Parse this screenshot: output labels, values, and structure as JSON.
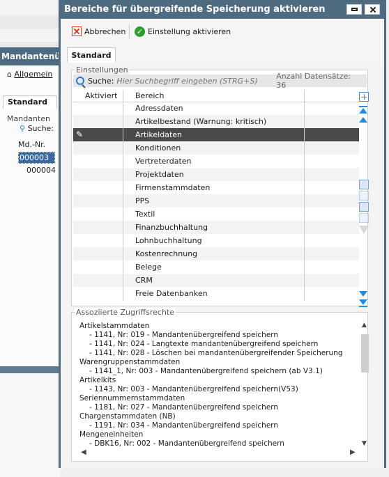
{
  "background_window": {
    "title": "Mandantenüb",
    "toolbar_item": "Allgemein",
    "tab": "Standard",
    "group_label": "Mandanten",
    "search_label": "Suche:",
    "column": "Md.-Nr.",
    "rows": [
      "000003",
      "000004"
    ]
  },
  "dialog": {
    "title": "Bereiche für übergreifende Speicherung aktivieren",
    "toolbar": {
      "cancel_label": "Abbrechen",
      "activate_label": "Einstellung aktivieren"
    },
    "tab": "Standard",
    "settings": {
      "group_label": "Einstellungen",
      "search_label": "Suche:",
      "search_placeholder": "Hier Suchbegriff eingeben (STRG+S)",
      "record_count": "Anzahl Datensätze: 36",
      "columns": [
        "Aktiviert",
        "Bereich"
      ],
      "selected_index": 2,
      "rows": [
        "Adressdaten",
        "Artikelbestand (Warnung: kritisch)",
        "Artikeldaten",
        "Konditionen",
        "Vertreterdaten",
        "Projektdaten",
        "Firmenstammdaten",
        "PPS",
        "Textil",
        "Finanzbuchhaltung",
        "Lohnbuchhaltung",
        "Kostenrechnung",
        "Belege",
        "CRM",
        "Freie Datenbanken"
      ]
    },
    "rights": {
      "group_label": "Assoziierte Zugriffsrechte",
      "lines": [
        {
          "text": "Artikelstammdaten",
          "indent": false
        },
        {
          "text": "- 1141, Nr: 019 - Mandantenübergreifend speichern",
          "indent": true
        },
        {
          "text": "- 1141, Nr: 024 - Langtexte mandantenübergreifend speichern",
          "indent": true
        },
        {
          "text": "- 1141, Nr: 028 - Löschen bei mandantenübergreifender Speicherung",
          "indent": true
        },
        {
          "text": "Warengruppenstammdaten",
          "indent": false
        },
        {
          "text": "- 1141_1, Nr: 003 - Mandantenübergreifend speichern (ab V3.1)",
          "indent": true
        },
        {
          "text": "Artikelkits",
          "indent": false
        },
        {
          "text": "- 1143, Nr: 003 - Mandantenübergreifend speichern(V53)",
          "indent": true
        },
        {
          "text": "Seriennummernstammdaten",
          "indent": false
        },
        {
          "text": "- 1181, Nr: 027 - Mandantenübergreifend speichern",
          "indent": true
        },
        {
          "text": "Chargenstammdaten (NB)",
          "indent": false
        },
        {
          "text": "- 1191, Nr: 034 - Mandantenübergreifend speichern",
          "indent": true
        },
        {
          "text": "Mengeneinheiten",
          "indent": false
        },
        {
          "text": "- DBK16, Nr: 002 - Mandantenübergreifend speichern",
          "indent": true
        }
      ]
    }
  }
}
